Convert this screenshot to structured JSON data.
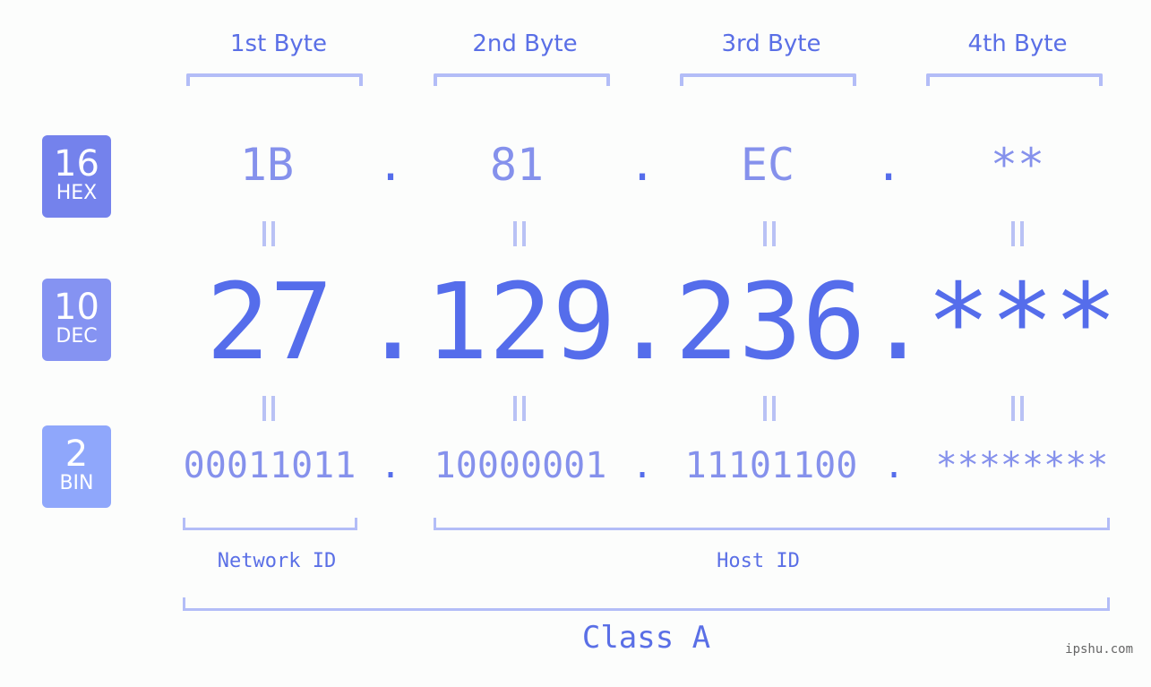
{
  "byte_headers": [
    "1st Byte",
    "2nd Byte",
    "3rd Byte",
    "4th Byte"
  ],
  "rows": {
    "hex": {
      "base": "16",
      "label": "HEX",
      "color": "#7482ec",
      "values": [
        "1B",
        "81",
        "EC",
        "**"
      ]
    },
    "dec": {
      "base": "10",
      "label": "DEC",
      "color": "#8593f2",
      "values": [
        "27",
        "129",
        "236",
        "***"
      ]
    },
    "bin": {
      "base": "2",
      "label": "BIN",
      "color": "#8fa7fb",
      "values": [
        "00011011",
        "10000001",
        "11101100",
        "********"
      ]
    }
  },
  "separator": ".",
  "segments": {
    "network": "Network ID",
    "host": "Host ID"
  },
  "class_label": "Class A",
  "credit": "ipshu.com",
  "colors": {
    "accent": "#556deb",
    "light": "#8591ec",
    "bracket": "#b3bdf7"
  }
}
